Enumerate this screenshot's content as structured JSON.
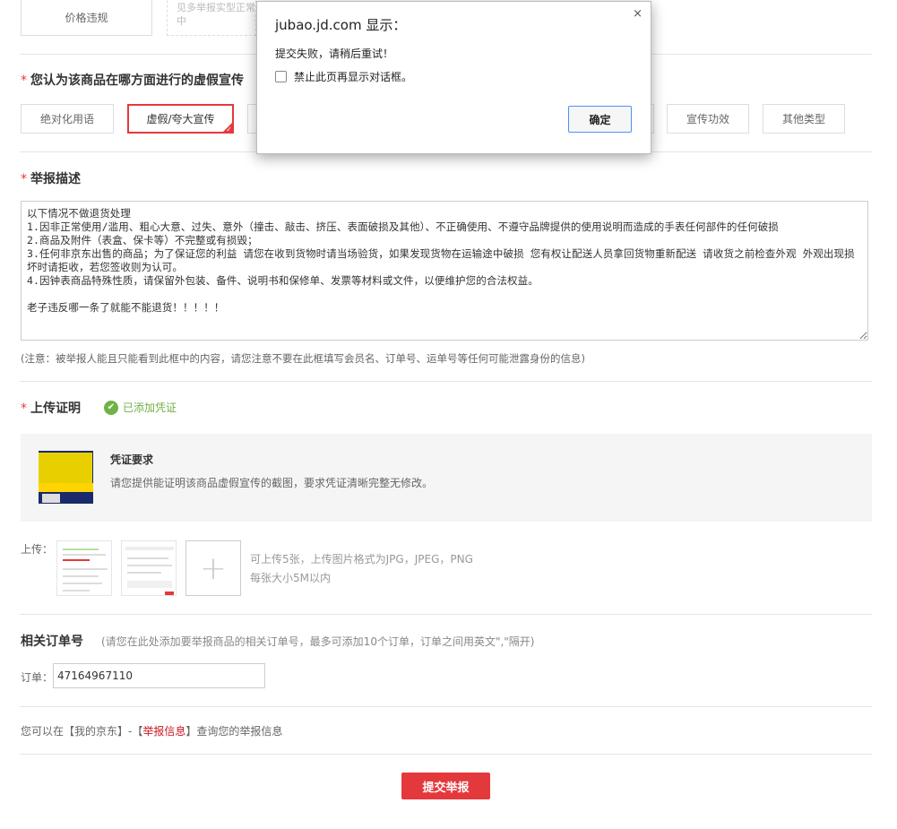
{
  "top": {
    "price_violation_label": "价格违规",
    "partial_text_top": "见多举报实型正常",
    "partial_text_bottom": "中"
  },
  "aspect": {
    "required_mark": "*",
    "title": "您认为该商品在哪方面进行的虚假宣传",
    "tags": [
      {
        "label": "绝对化用语",
        "selected": false
      },
      {
        "label": "虚假/夸大宣传",
        "selected": true
      },
      {
        "label": "宣传功效",
        "selected": false
      },
      {
        "label": "其他类型",
        "selected": false
      }
    ]
  },
  "description": {
    "required_mark": "*",
    "title": "举报描述",
    "value": "以下情况不做退货处理\n1.因非正常使用/滥用、粗心大意、过失、意外（撞击、敲击、挤压、表面破损及其他）、不正确使用、不遵守品牌提供的使用说明而造成的手表任何部件的任何破损\n2.商品及附件（表盒、保卡等）不完整或有损毁；\n3.任何非京东出售的商品；为了保证您的利益 请您在收到货物时请当场验货，如果发现货物在运输途中破损 您有权让配送人员拿回货物重新配送 请收货之前检查外观 外观出现损坏时请拒收，若您签收则为认可。\n4.因钟表商品特殊性质，请保留外包装、备件、说明书和保修单、发票等材料或文件，以便维护您的合法权益。\n\n老子违反哪一条了就能不能退货！！！！！",
    "note": "(注意：被举报人能且只能看到此框中的内容，请您注意不要在此框填写会员名、订单号、运单号等任何可能泄露身份的信息)"
  },
  "upload": {
    "required_mark": "*",
    "title": "上传证明",
    "added_status": "已添加凭证",
    "proof_title": "凭证要求",
    "proof_desc": "请您提供能证明该商品虚假宣传的截图，要求凭证清晰完整无修改。",
    "upload_label": "上传：",
    "hint_line1": "可上传5张，上传图片格式为JPG，JPEG，PNG",
    "hint_line2": "每张大小5M以内"
  },
  "order": {
    "title": "相关订单号",
    "hint": "(请您在此处添加要举报商品的相关订单号，最多可添加10个订单，订单之间用英文\",\"隔开)",
    "label": "订单：",
    "value": "47164967110"
  },
  "footer": {
    "text_before": "您可以在【我的京东】-【",
    "link": "举报信息",
    "text_after": "】查询您的举报信息",
    "submit_label": "提交举报"
  },
  "dialog": {
    "title": "jubao.jd.com 显示：",
    "close": "×",
    "message": "提交失败，请稍后重试！",
    "checkbox_label": "禁止此页再显示对话框。",
    "ok_label": "确定"
  },
  "colors": {
    "accent": "#e4393c",
    "success": "#71b247",
    "link": "#c81623"
  }
}
